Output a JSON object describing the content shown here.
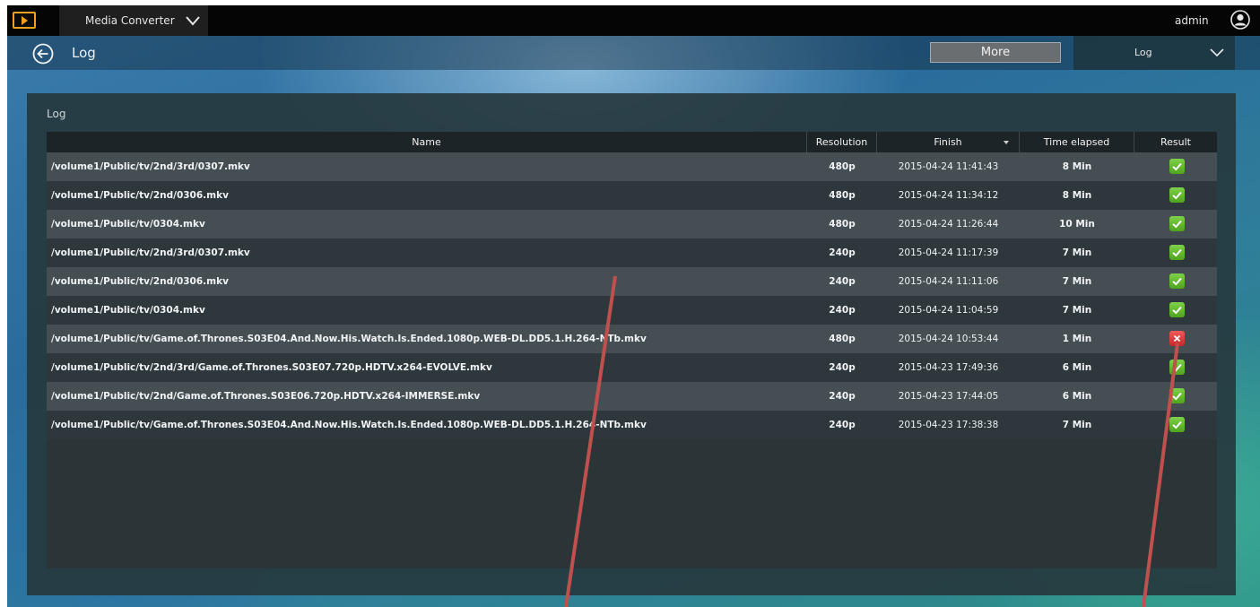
{
  "topbar": {
    "app_name": "Media Converter",
    "user_name": "admin"
  },
  "header": {
    "title": "Log",
    "more_label": "More",
    "view_select_value": "Log"
  },
  "panel": {
    "title": "Log"
  },
  "table": {
    "columns": [
      "Name",
      "Resolution",
      "Finish",
      "Time elapsed",
      "Result"
    ],
    "sorted_column": "Finish",
    "rows": [
      {
        "name": "/volume1/Public/tv/2nd/3rd/0307.mkv",
        "resolution": "480p",
        "finish": "2015-04-24 11:41:43",
        "elapsed": "8 Min",
        "result": "success"
      },
      {
        "name": "/volume1/Public/tv/2nd/0306.mkv",
        "resolution": "480p",
        "finish": "2015-04-24 11:34:12",
        "elapsed": "8 Min",
        "result": "success"
      },
      {
        "name": "/volume1/Public/tv/0304.mkv",
        "resolution": "480p",
        "finish": "2015-04-24 11:26:44",
        "elapsed": "10 Min",
        "result": "success"
      },
      {
        "name": "/volume1/Public/tv/2nd/3rd/0307.mkv",
        "resolution": "240p",
        "finish": "2015-04-24 11:17:39",
        "elapsed": "7 Min",
        "result": "success"
      },
      {
        "name": "/volume1/Public/tv/2nd/0306.mkv",
        "resolution": "240p",
        "finish": "2015-04-24 11:11:06",
        "elapsed": "7 Min",
        "result": "success"
      },
      {
        "name": "/volume1/Public/tv/0304.mkv",
        "resolution": "240p",
        "finish": "2015-04-24 11:04:59",
        "elapsed": "7 Min",
        "result": "success"
      },
      {
        "name": "/volume1/Public/tv/Game.of.Thrones.S03E04.And.Now.His.Watch.Is.Ended.1080p.WEB-DL.DD5.1.H.264-NTb.mkv",
        "resolution": "480p",
        "finish": "2015-04-24 10:53:44",
        "elapsed": "1 Min",
        "result": "failure"
      },
      {
        "name": "/volume1/Public/tv/2nd/3rd/Game.of.Thrones.S03E07.720p.HDTV.x264-EVOLVE.mkv",
        "resolution": "240p",
        "finish": "2015-04-23 17:49:36",
        "elapsed": "6 Min",
        "result": "success"
      },
      {
        "name": "/volume1/Public/tv/2nd/Game.of.Thrones.S03E06.720p.HDTV.x264-IMMERSE.mkv",
        "resolution": "240p",
        "finish": "2015-04-23 17:44:05",
        "elapsed": "6 Min",
        "result": "success"
      },
      {
        "name": "/volume1/Public/tv/Game.of.Thrones.S03E04.And.Now.His.Watch.Is.Ended.1080p.WEB-DL.DD5.1.H.264-NTb.mkv",
        "resolution": "240p",
        "finish": "2015-04-23 17:38:38",
        "elapsed": "7 Min",
        "result": "success"
      }
    ]
  },
  "icons": {
    "logo": "play-icon",
    "app_switch": "chevron-down-icon",
    "user": "user-icon",
    "back": "back-arrow-icon",
    "view_select": "chevron-down-icon",
    "success": "check-icon",
    "failure": "error-icon"
  },
  "colors": {
    "logo_accent": "#f0a020",
    "success": "#5cb82a",
    "failure": "#d83a3a",
    "annotation_line": "#c0504d"
  }
}
